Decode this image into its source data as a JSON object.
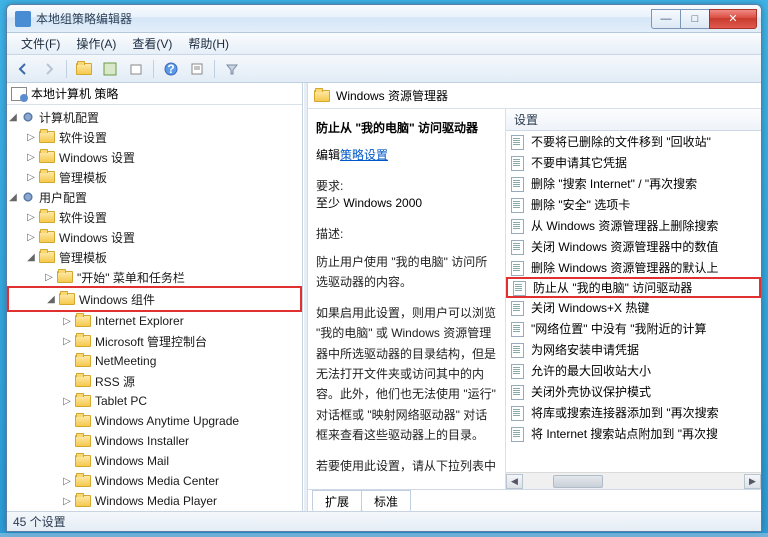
{
  "window": {
    "title": "本地组策略编辑器",
    "min": "—",
    "max": "□",
    "close": "✕"
  },
  "menu": {
    "file": "文件(F)",
    "action": "操作(A)",
    "view": "查看(V)",
    "help": "帮助(H)"
  },
  "tree": {
    "root": "本地计算机 策略",
    "computer_config": "计算机配置",
    "user_config": "用户配置",
    "software_settings": "软件设置",
    "windows_settings": "Windows 设置",
    "admin_templates": "管理模板",
    "start_taskbar": "\"开始\" 菜单和任务栏",
    "windows_components": "Windows 组件",
    "ie": "Internet Explorer",
    "ms_console": "Microsoft 管理控制台",
    "netmeeting": "NetMeeting",
    "rss": "RSS 源",
    "tabletpc": "Tablet PC",
    "anytime": "Windows Anytime Upgrade",
    "installer": "Windows Installer",
    "mail": "Windows Mail",
    "mediacenter": "Windows Media Center",
    "mediaplayer": "Windows Media Player"
  },
  "right": {
    "header": "Windows 资源管理器",
    "desc_title": "防止从 \"我的电脑\" 访问驱动器",
    "edit_label": "编辑",
    "edit_link": "策略设置",
    "req_label": "要求:",
    "req_value": "至少 Windows 2000",
    "desc_label": "描述:",
    "desc_body1": "防止用户使用 \"我的电脑\" 访问所选驱动器的内容。",
    "desc_body2": "如果启用此设置，则用户可以浏览 \"我的电脑\" 或 Windows 资源管理器中所选驱动器的目录结构，但是无法打开文件夹或访问其中的内容。此外，他们也无法使用 \"运行\" 对话框或 \"映射网络驱动器\" 对话框来查看这些驱动器上的目录。",
    "desc_body3": "若要使用此设置，请从下拉列表中",
    "list_header": "设置",
    "tab_extended": "扩展",
    "tab_standard": "标准",
    "items": [
      "不要将已删除的文件移到 \"回收站\"",
      "不要申请其它凭据",
      "删除 \"搜索 Internet\" / \"再次搜索",
      "删除 \"安全\" 选项卡",
      "从 Windows 资源管理器上删除搜索",
      "关闭 Windows 资源管理器中的数值",
      "删除 Windows 资源管理器的默认上",
      "防止从 \"我的电脑\" 访问驱动器",
      "关闭 Windows+X 热键",
      "\"网络位置\" 中没有 \"我附近的计算",
      "为网络安装申请凭据",
      "允许的最大回收站大小",
      "关闭外壳协议保护模式",
      "将库或搜索连接器添加到 \"再次搜索",
      "将 Internet 搜索站点附加到 \"再次搜"
    ]
  },
  "status": "45 个设置"
}
